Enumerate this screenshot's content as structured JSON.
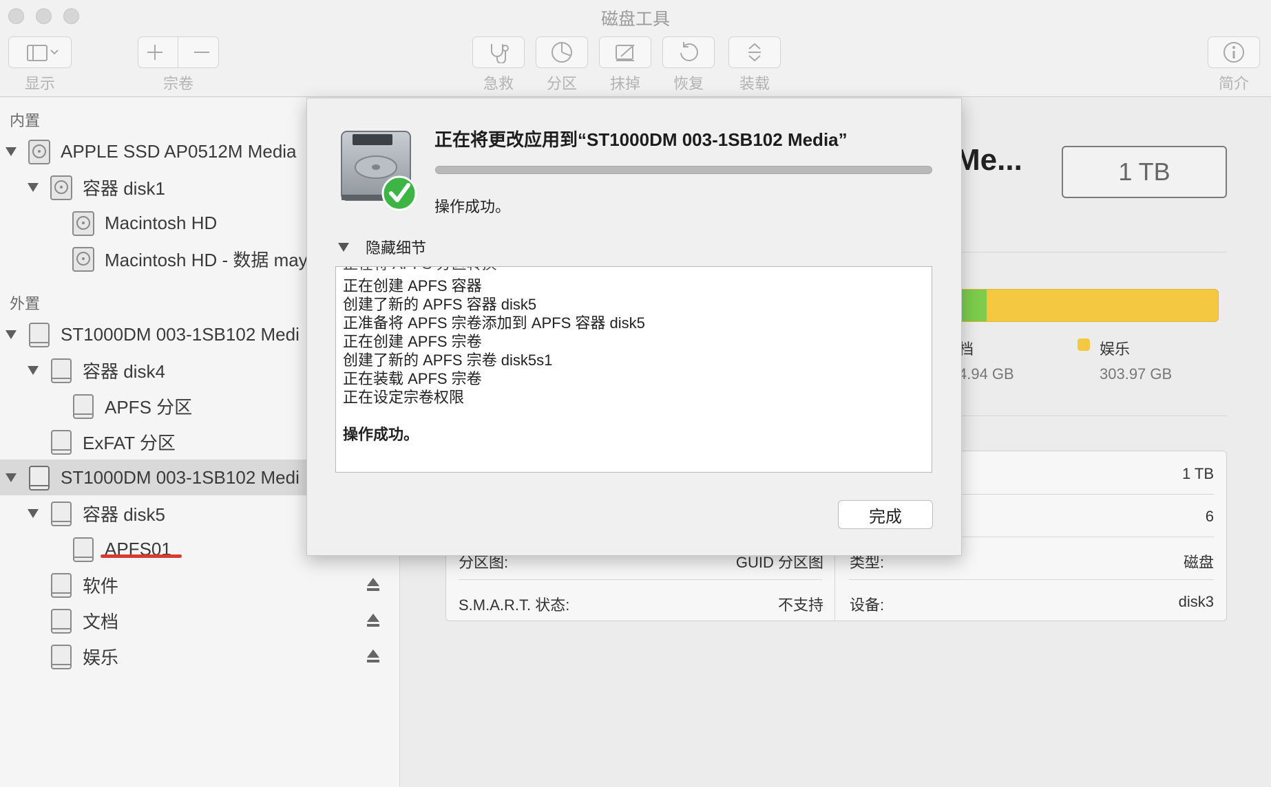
{
  "window": {
    "title": "磁盘工具"
  },
  "toolbar": {
    "view_label": "显示",
    "volume_label": "宗卷",
    "rescue_label": "急救",
    "partition_label": "分区",
    "erase_label": "抹掉",
    "restore_label": "恢复",
    "mount_label": "装载",
    "info_label": "简介"
  },
  "sidebar": {
    "internal_header": "内置",
    "external_header": "外置",
    "items": [
      {
        "label": "APPLE SSD AP0512M Media"
      },
      {
        "label": "容器 disk1"
      },
      {
        "label": "Macintosh HD"
      },
      {
        "label": "Macintosh HD - 数据 may"
      },
      {
        "label": "ST1000DM 003-1SB102 Medi"
      },
      {
        "label": "容器 disk4"
      },
      {
        "label": "APFS 分区"
      },
      {
        "label": "ExFAT 分区"
      },
      {
        "label": "ST1000DM 003-1SB102 Medi"
      },
      {
        "label": "容器 disk5"
      },
      {
        "label": "APFS01"
      },
      {
        "label": "软件"
      },
      {
        "label": "文档"
      },
      {
        "label": "娱乐"
      }
    ]
  },
  "main": {
    "device_name": "Me...",
    "capacity": "1 TB",
    "usage": {
      "fraction_green": 0.11
    },
    "legend": [
      {
        "name": "档",
        "value": "4.94 GB"
      },
      {
        "name": "娱乐",
        "value": "303.97 GB"
      }
    ],
    "info": {
      "capacity_value": "1 TB",
      "child_count_value": "6",
      "partition_map_label": "分区图:",
      "partition_map_value": "GUID 分区图",
      "type_label": "类型:",
      "type_value": "磁盘",
      "smart_label": "S.M.A.R.T. 状态:",
      "smart_value": "不支持",
      "device_label": "设备:",
      "device_value": "disk3"
    }
  },
  "sheet": {
    "title": "正在将更改应用到“ST1000DM 003-1SB102 Media”",
    "progress": 1.0,
    "status": "操作成功。",
    "details_toggle": "隐藏细节",
    "log": [
      "正在创建 APFS 容器",
      "创建了新的 APFS 容器 disk5",
      "正准备将 APFS 宗卷添加到 APFS 容器 disk5",
      "正在创建 APFS 宗卷",
      "创建了新的 APFS 宗卷 disk5s1",
      "正在装载 APFS 宗卷",
      "正在设定宗卷权限",
      "",
      "操作成功。"
    ],
    "done_label": "完成"
  },
  "colors": {
    "selection": "#d9d9d9",
    "usage_green": "#7dcc4d",
    "usage_yellow": "#f5c842",
    "annotation_red": "#d93a2f"
  }
}
